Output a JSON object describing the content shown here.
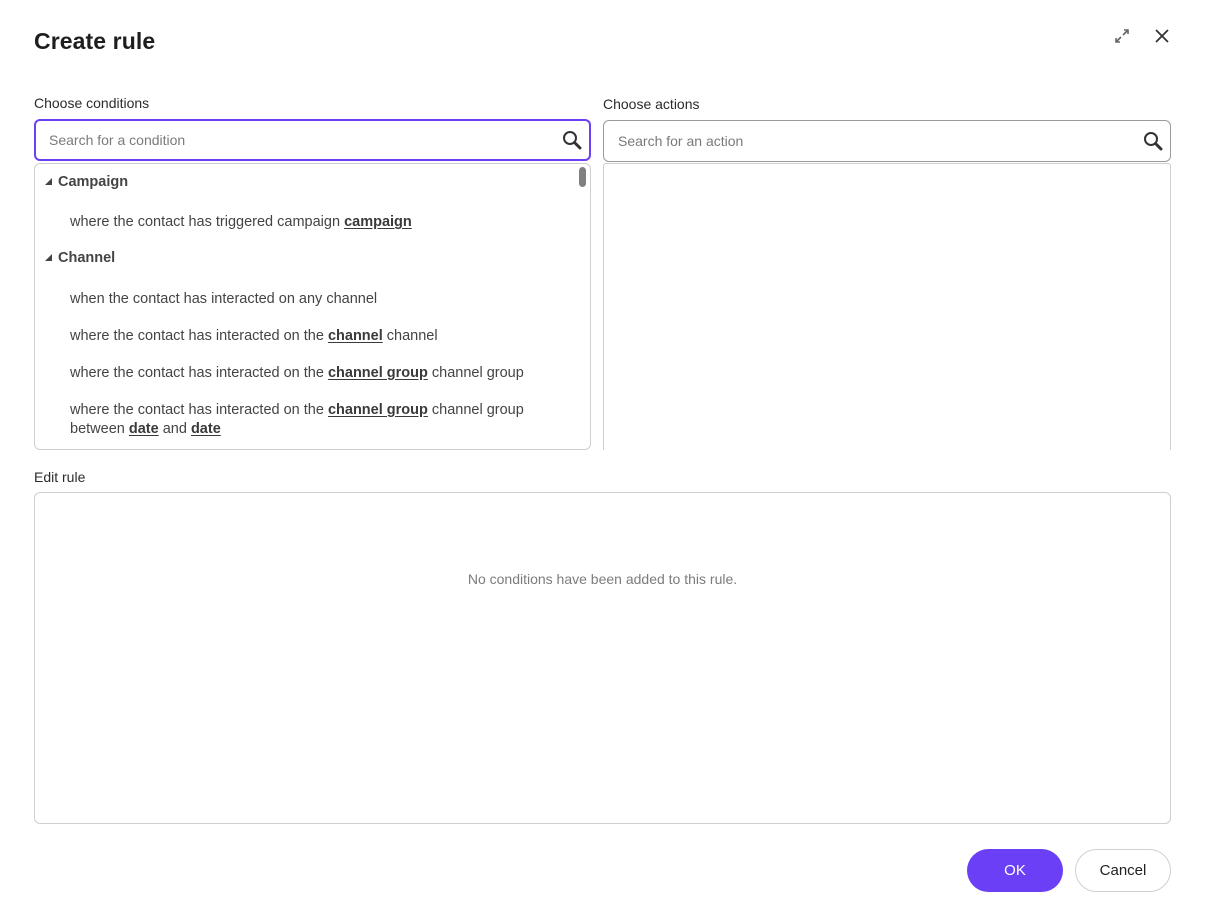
{
  "dialog": {
    "title": "Create rule",
    "expand_icon": "expand-icon",
    "close_icon": "close-icon"
  },
  "conditions": {
    "label": "Choose conditions",
    "search_placeholder": "Search for a condition",
    "search_value": "",
    "groups": [
      {
        "name": "Campaign",
        "items": [
          {
            "parts": [
              "where the contact has triggered campaign ",
              "campaign",
              ""
            ]
          }
        ]
      },
      {
        "name": "Channel",
        "items": [
          {
            "parts": [
              "when the contact has interacted on any channel"
            ]
          },
          {
            "parts": [
              "where the contact has interacted on the ",
              "channel",
              " channel"
            ]
          },
          {
            "parts": [
              "where the contact has interacted on the ",
              "channel group",
              " channel group"
            ]
          },
          {
            "parts": [
              "where the contact has interacted on the ",
              "channel group",
              " channel group between ",
              "date",
              " and ",
              "date",
              ""
            ]
          }
        ]
      }
    ]
  },
  "actions": {
    "label": "Choose actions",
    "search_placeholder": "Search for an action",
    "search_value": ""
  },
  "edit_rule": {
    "label": "Edit rule",
    "empty_message": "No conditions have been added to this rule."
  },
  "buttons": {
    "ok": "OK",
    "cancel": "Cancel"
  },
  "colors": {
    "accent": "#6a3ff5",
    "border": "#cfcfcf",
    "text": "#444444"
  }
}
